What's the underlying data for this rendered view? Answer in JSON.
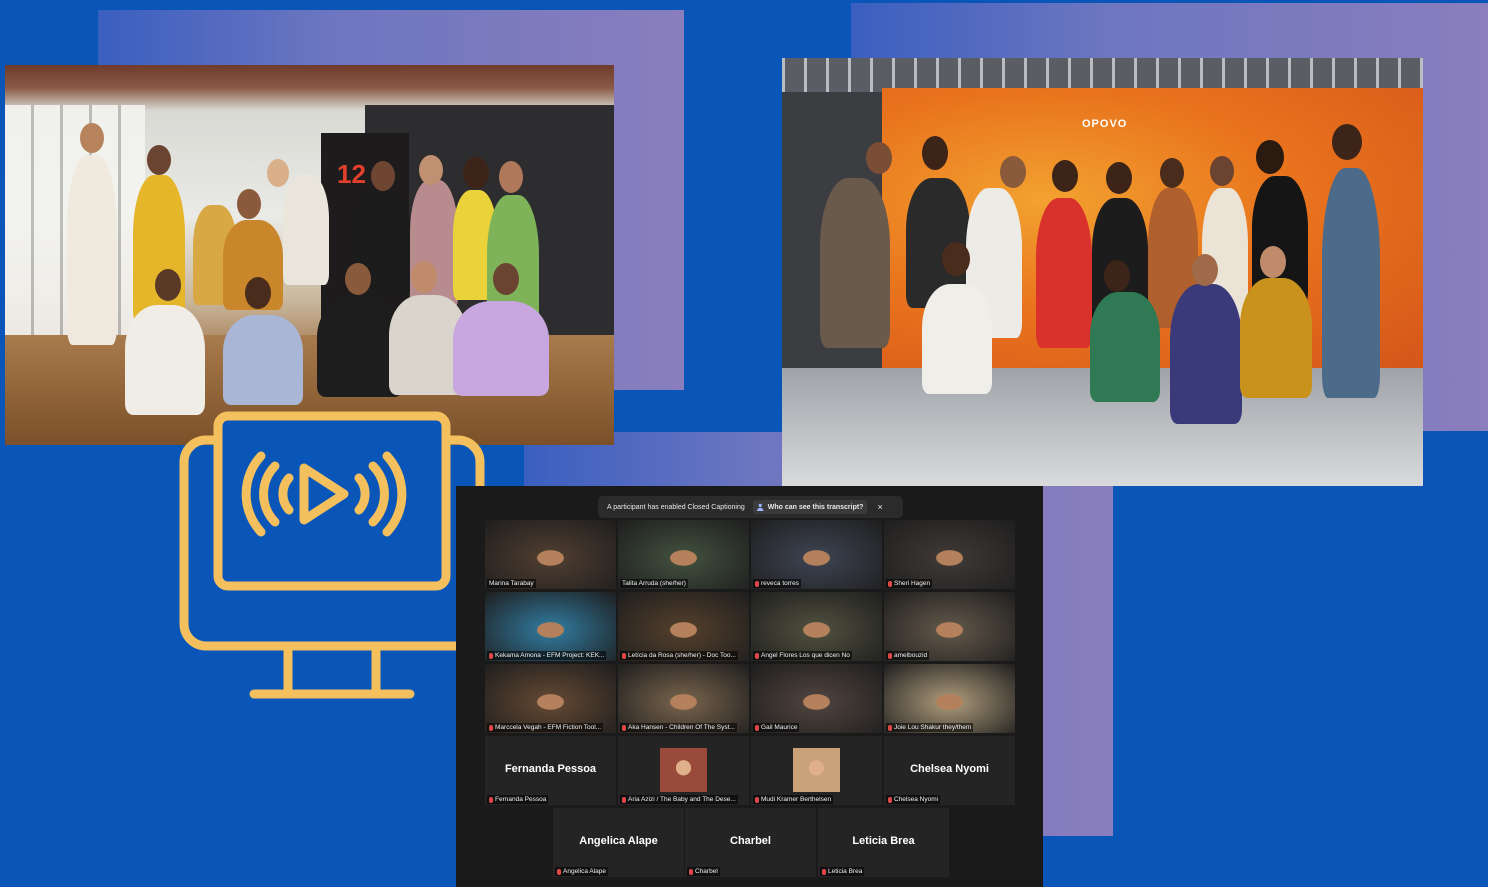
{
  "photo1": {
    "banner_text": "12"
  },
  "photo2": {
    "logos_text": "OPOVO"
  },
  "zoom": {
    "cc_banner": {
      "message": "A participant has enabled Closed Captioning",
      "who_button": "Who can see this transcript?",
      "close": "×"
    },
    "tiles": [
      {
        "label": "Marina Tarabay",
        "type": "video",
        "bg": "#4a3a2e",
        "active": true
      },
      {
        "label": "Talita Arruda (she/her)",
        "type": "video",
        "bg": "#3d4a3a"
      },
      {
        "label": "reveca torres",
        "type": "video",
        "bg": "#3a3f4c",
        "muted": true
      },
      {
        "label": "Sheri Hagen",
        "type": "video",
        "bg": "#3b3633",
        "muted": true
      },
      {
        "label": "Kekama Amona - EFM Project: KEK...",
        "type": "video",
        "bg": "#2f6f8f",
        "muted": true
      },
      {
        "label": "Letícia da Rosa (she/her) - Doc Too...",
        "type": "video",
        "bg": "#4d3b2a",
        "muted": true
      },
      {
        "label": "Angel Flores Los que dicen No",
        "type": "video",
        "bg": "#4a4a3a",
        "muted": true
      },
      {
        "label": "amelbouzid",
        "type": "video",
        "bg": "#5a5044",
        "muted": true
      },
      {
        "label": "Marccela Vegah - EFM Fiction Tool...",
        "type": "video",
        "bg": "#5b4330",
        "muted": true
      },
      {
        "label": "Aka Hansen - Children Of The Syst...",
        "type": "video",
        "bg": "#6c5a46",
        "muted": true
      },
      {
        "label": "Gail Maurice",
        "type": "video",
        "bg": "#4a3f3a",
        "muted": true
      },
      {
        "label": "Joie Lou Shakur they/them",
        "type": "video",
        "bg": "#9a8a6e",
        "muted": true
      },
      {
        "label": "Fernanda Pessoa",
        "type": "name",
        "name": "Fernanda Pessoa",
        "muted": true
      },
      {
        "label": "Aria Azizi / The Baby and The Dese...",
        "type": "avatar",
        "bg": "#9a4a3a",
        "muted": true
      },
      {
        "label": "Mudi Kramer Berthelsen",
        "type": "avatar",
        "bg": "#c9a27a",
        "muted": true
      },
      {
        "label": "Chelsea Nyomi",
        "type": "name",
        "name": "Chelsea Nyomi",
        "muted": true
      },
      {
        "label": "Angelica Alape",
        "type": "name",
        "name": "Angelica Alape",
        "muted": true
      },
      {
        "label": "Charbel",
        "type": "name",
        "name": "Charbel",
        "muted": true
      },
      {
        "label": "Leticia Brea",
        "type": "name",
        "name": "Leticia Brea",
        "muted": true
      }
    ]
  },
  "colors": {
    "background": "#0a55b8",
    "icon_stroke": "#f4c05e",
    "active_speaker": "#c8d84a"
  },
  "icons": [
    "monitor-play-icon",
    "person-icon",
    "microphone-muted-icon",
    "close-icon"
  ]
}
